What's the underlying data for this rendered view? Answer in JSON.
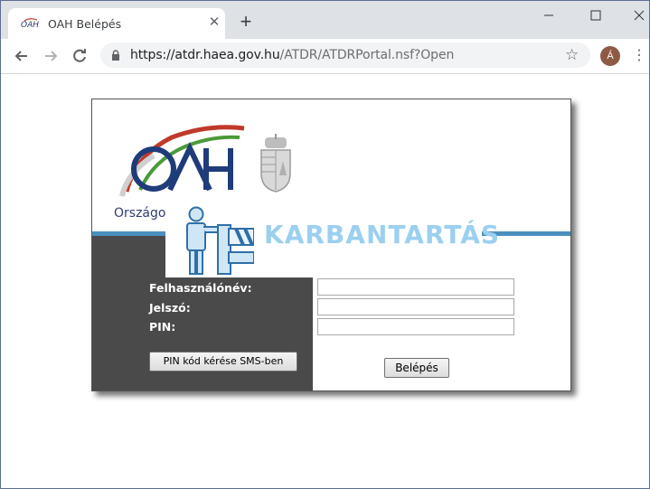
{
  "browser": {
    "tab_title": "OAH Belépés",
    "new_tab_symbol": "+",
    "url_host": "https://atdr.haea.gov.hu",
    "url_path": "/ATDR/ATDRPortal.nsf?Open",
    "avatar_letter": "Á"
  },
  "page": {
    "org_text": "Országos",
    "maintenance_text": "KARBANTARTÁS",
    "form": {
      "username_label": "Felhasználónév:",
      "password_label": "Jelszó:",
      "pin_label": "PIN:",
      "username_value": "",
      "password_value": "",
      "pin_value": "",
      "sms_button": "PIN kód kérése SMS-ben",
      "login_button": "Belépés"
    },
    "colors": {
      "accent_blue": "#4a90bf",
      "dark_panel": "#4a4a4a",
      "maintenance_text": "#9bd0f0"
    }
  }
}
